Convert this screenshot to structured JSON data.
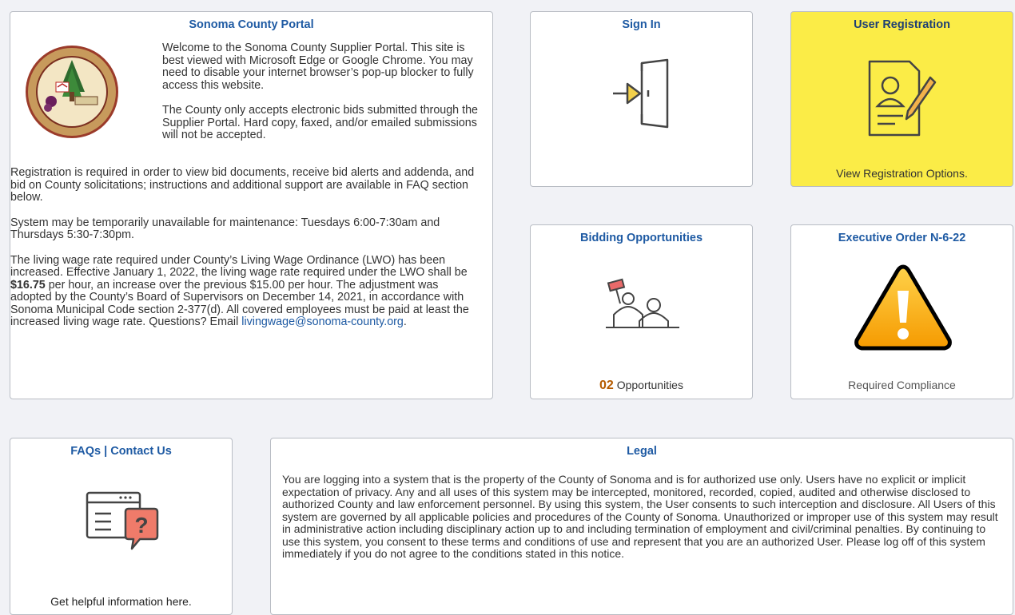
{
  "portal": {
    "title": "Sonoma County Portal",
    "seal_text_top": "SONOMA COUNTY",
    "seal_text_bottom": "CALIFORNIA",
    "seal_year_left": "18",
    "seal_year_right": "50",
    "seal_motto": [
      "AGRICULTURE",
      "INDUSTRY",
      "RECREATION"
    ],
    "intro_1": "Welcome to the Sonoma County Supplier Portal. This site is best viewed with Microsoft Edge or Google Chrome. You may need to disable your internet browser’s pop-up blocker to fully access this website.",
    "intro_2": "The County only accepts electronic bids submitted through the Supplier Portal. Hard copy, faxed, and/or emailed submissions will not be accepted.",
    "registration": "Registration is required in order to view bid documents, receive bid alerts and addenda, and bid on County solicitations; instructions and additional support are available in FAQ section below.",
    "maintenance": "System may be temporarily unavailable for maintenance: Tuesdays 6:00-7:30am and Thursdays 5:30-7:30pm.",
    "lwo_before": "The living wage rate required under County’s Living Wage Ordinance (LWO) has been increased. Effective January 1, 2022, the living wage rate required under the LWO shall be ",
    "lwo_rate": "$16.75",
    "lwo_after": " per hour, an increase over the previous $15.00 per hour. The adjustment was adopted by the County’s Board of Supervisors on December 14, 2021, in accordance with Sonoma Municipal Code section 2-377(d). All covered employees must be paid at least the increased living wage rate. Questions? Email ",
    "lwo_email": "livingwage@sonoma-county.org",
    "lwo_end": "."
  },
  "sign_in": {
    "title": "Sign In",
    "icon": "sign-in-door-icon"
  },
  "registration_tile": {
    "title": "User Registration",
    "icon": "registration-form-icon",
    "footer": "View Registration Options.",
    "bg": "#fbec47"
  },
  "bidding": {
    "title": "Bidding Opportunities",
    "icon": "bidding-auction-icon",
    "count": "02",
    "count_label": "Opportunities"
  },
  "executive": {
    "title": "Executive Order N-6-22",
    "icon": "warning-icon",
    "footer": "Required Compliance"
  },
  "faq": {
    "title": "FAQs | Contact Us",
    "icon": "faq-help-icon",
    "footer": "Get helpful information here."
  },
  "legal": {
    "title": "Legal",
    "text": "You are logging into a system that is the property of the County of Sonoma and is for authorized use only. Users have no explicit or implicit expectation of privacy. Any and all uses of this system may be intercepted, monitored, recorded, copied, audited and otherwise disclosed to authorized County and law enforcement personnel. By using this system, the User consents to such interception and disclosure. All Users of this system are governed by all applicable policies and procedures of the County of Sonoma. Unauthorized or improper use of this system may result in administrative action including disciplinary action up to and including termination of employment and civil/criminal penalties. By continuing to use this system, you consent to these terms and conditions of use and represent that you are an authorized User. Please log off of this system immediately if you do not agree to the conditions stated in this notice."
  }
}
